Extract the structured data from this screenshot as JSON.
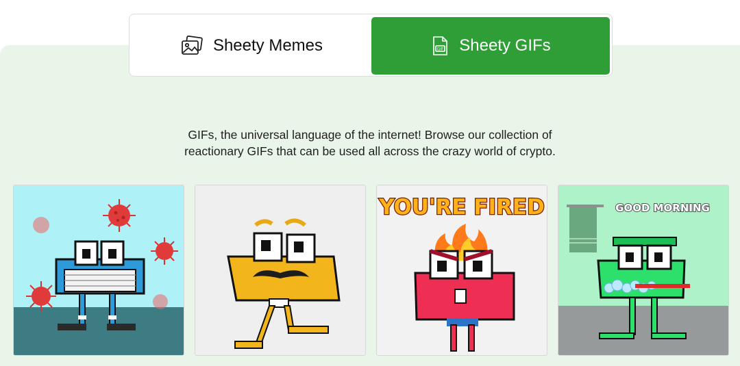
{
  "tabs": [
    {
      "label": "Sheety Memes",
      "icon": "images-icon",
      "active": false
    },
    {
      "label": "Sheety GIFs",
      "icon": "gif-file-icon",
      "active": true
    }
  ],
  "description": {
    "line1": "GIFs, the universal language of the internet! Browse our collection of",
    "line2": "reactionary GIFs that can be used all across the crazy world of crypto."
  },
  "gifs": [
    {
      "caption": ""
    },
    {
      "caption": ""
    },
    {
      "caption": "YOU'RE FIRED"
    },
    {
      "caption": "GOOD MORNING"
    }
  ],
  "colors": {
    "accent": "#2f9e36",
    "panel_background": "#eaf5ea"
  }
}
